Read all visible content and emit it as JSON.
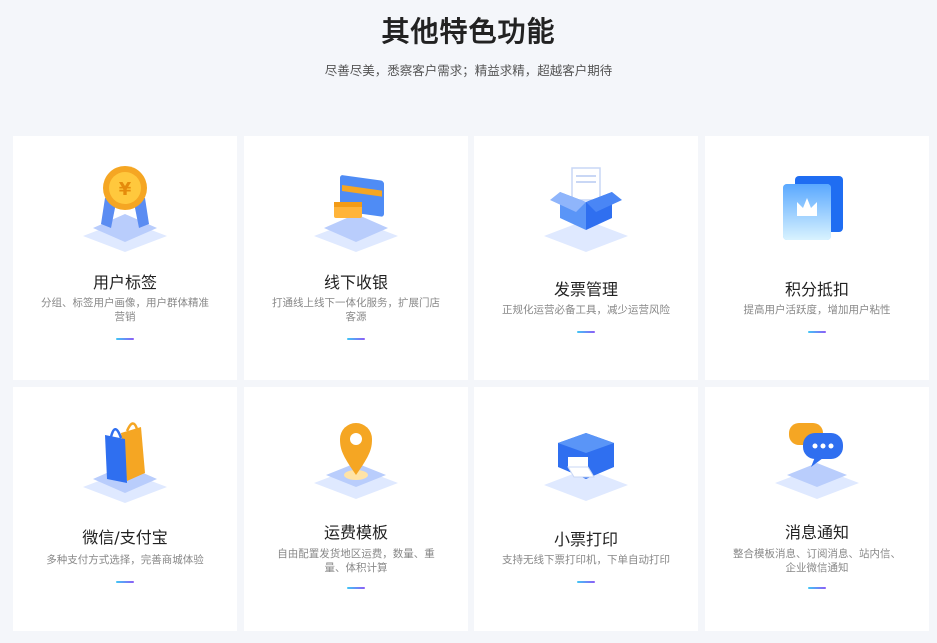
{
  "header": {
    "title": "其他特色功能",
    "subtitle": "尽善尽美，悉察客户需求；精益求精，超越客户期待"
  },
  "features": [
    {
      "title": "用户标签",
      "desc": "分组、标签用户画像，用户群体精准营销",
      "icon": "medal-icon"
    },
    {
      "title": "线下收银",
      "desc": "打通线上线下一体化服务，扩展门店客源",
      "icon": "card-payment-icon"
    },
    {
      "title": "发票管理",
      "desc": "正规化运营必备工具，减少运营风险",
      "icon": "invoice-box-icon"
    },
    {
      "title": "积分抵扣",
      "desc": "提高用户活跃度，增加用户粘性",
      "icon": "crown-points-icon"
    },
    {
      "title": "微信/支付宝",
      "desc": "多种支付方式选择，完善商城体验",
      "icon": "shopping-bag-icon"
    },
    {
      "title": "运费模板",
      "desc": "自由配置发货地区运费，数量、重量、体积计算",
      "icon": "location-pin-icon"
    },
    {
      "title": "小票打印",
      "desc": "支持无线下票打印机，下单自动打印",
      "icon": "printer-icon"
    },
    {
      "title": "消息通知",
      "desc": "整合模板消息、订阅消息、站内信、企业微信通知",
      "icon": "chat-bubble-icon"
    }
  ]
}
